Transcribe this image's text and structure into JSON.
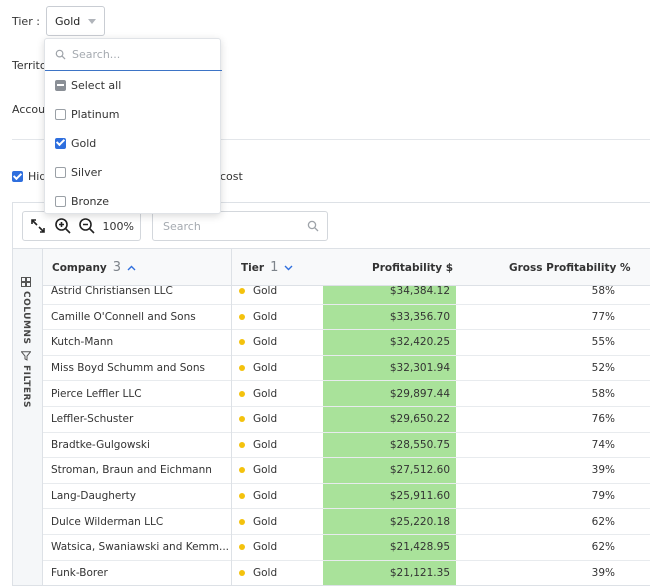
{
  "filters": {
    "tier_label": "Tier :",
    "tier_value": "Gold",
    "territory_label": "Territo",
    "account_label": "Accou"
  },
  "hide_option": {
    "label_visible_start": "Hid",
    "label_visible_end": "cost",
    "checked": true
  },
  "dropdown": {
    "search_placeholder": "Search...",
    "items": [
      {
        "label": "Select all",
        "state": "partial"
      },
      {
        "label": "Platinum",
        "state": "unchecked"
      },
      {
        "label": "Gold",
        "state": "checked"
      },
      {
        "label": "Silver",
        "state": "unchecked"
      },
      {
        "label": "Bronze",
        "state": "unchecked"
      }
    ]
  },
  "toolbar": {
    "zoom": "100%",
    "search_placeholder": "Search"
  },
  "side_tabs": {
    "columns": "COLUMNS",
    "filters": "FILTERS"
  },
  "columns": {
    "company": "Company",
    "company_sort_index": "3",
    "tier": "Tier",
    "tier_sort_index": "1",
    "profit": "Profitability $",
    "gross": "Gross Profitability %"
  },
  "rows": [
    {
      "company": "Astrid Christiansen LLC",
      "tier": "Gold",
      "profit": "$34,384.12",
      "gross": "58%"
    },
    {
      "company": "Camille O'Connell and Sons",
      "tier": "Gold",
      "profit": "$33,356.70",
      "gross": "77%"
    },
    {
      "company": "Kutch-Mann",
      "tier": "Gold",
      "profit": "$32,420.25",
      "gross": "55%"
    },
    {
      "company": "Miss Boyd Schumm and Sons",
      "tier": "Gold",
      "profit": "$32,301.94",
      "gross": "52%"
    },
    {
      "company": "Pierce Leffler LLC",
      "tier": "Gold",
      "profit": "$29,897.44",
      "gross": "58%"
    },
    {
      "company": "Leffler-Schuster",
      "tier": "Gold",
      "profit": "$29,650.22",
      "gross": "76%"
    },
    {
      "company": "Bradtke-Gulgowski",
      "tier": "Gold",
      "profit": "$28,550.75",
      "gross": "74%"
    },
    {
      "company": "Stroman, Braun and Eichmann",
      "tier": "Gold",
      "profit": "$27,512.60",
      "gross": "39%"
    },
    {
      "company": "Lang-Daugherty",
      "tier": "Gold",
      "profit": "$25,911.60",
      "gross": "79%"
    },
    {
      "company": "Dulce Wilderman LLC",
      "tier": "Gold",
      "profit": "$25,220.18",
      "gross": "62%"
    },
    {
      "company": "Watsica, Swaniawski and Kemm...",
      "tier": "Gold",
      "profit": "$21,428.95",
      "gross": "62%"
    },
    {
      "company": "Funk-Borer",
      "tier": "Gold",
      "profit": "$21,121.35",
      "gross": "39%"
    }
  ],
  "colors": {
    "profit_fill": "#a9e29a",
    "gold_dot": "#f4c20d",
    "accent": "#2f6fde"
  }
}
